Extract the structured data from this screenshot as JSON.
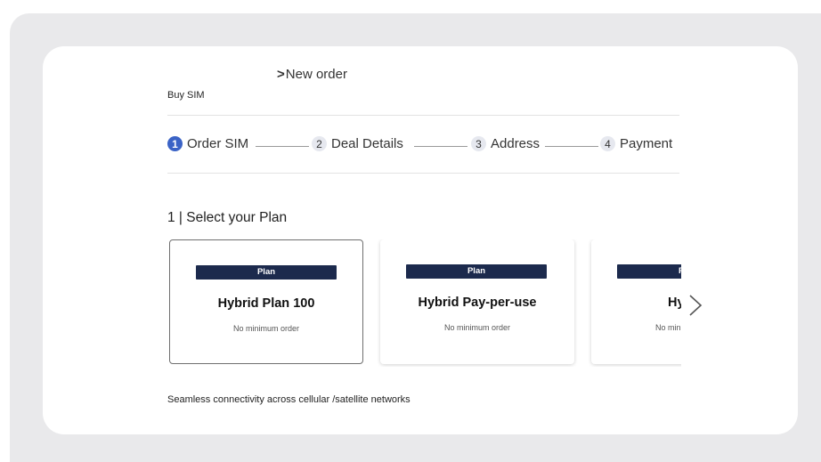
{
  "breadcrumb": {
    "current": "New order",
    "parent": "Buy SIM"
  },
  "steps": [
    {
      "number": "1",
      "label": "Order SIM",
      "active": true
    },
    {
      "number": "2",
      "label": "Deal Details",
      "active": false
    },
    {
      "number": "3",
      "label": "Address",
      "active": false
    },
    {
      "number": "4",
      "label": "Payment",
      "active": false
    }
  ],
  "section": {
    "title": "1 | Select your Plan"
  },
  "plans": [
    {
      "tag": "Plan",
      "name": "Hybrid Plan 100",
      "subtitle": "No minimum order",
      "selected": true
    },
    {
      "tag": "Plan",
      "name": "Hybrid Pay-per-use",
      "subtitle": "No minimum order",
      "selected": false
    },
    {
      "tag": "Plan",
      "name": "Hybrid",
      "subtitle": "No minimum order",
      "selected": false
    }
  ],
  "carousel": {
    "next_icon": "chevron-right-icon"
  },
  "footer": {
    "text": "Seamless connectivity across cellular /satellite networks"
  },
  "colors": {
    "active_step": "#3b63c6",
    "plan_tag": "#1c2a4d",
    "outer_background": "#e9e9eb"
  }
}
